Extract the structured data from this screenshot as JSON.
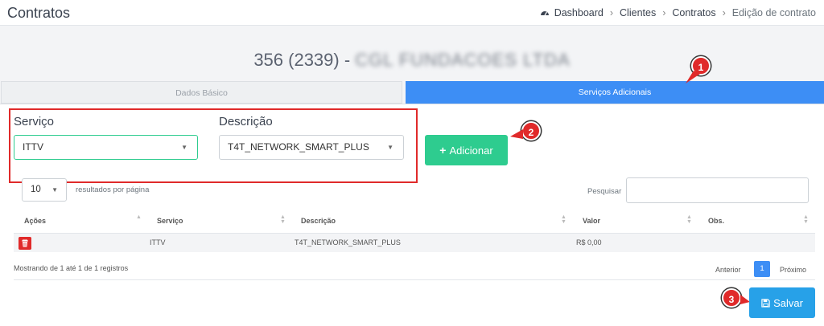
{
  "header": {
    "title": "Contratos",
    "breadcrumb": [
      "Dashboard",
      "Clientes",
      "Contratos",
      "Edição de contrato"
    ]
  },
  "contract": {
    "number": "356 (2339) -",
    "client_name": "CGL FUNDACOES LTDA"
  },
  "tabs": [
    {
      "label": "Dados Básico",
      "active": false
    },
    {
      "label": "Serviços Adicionais",
      "active": true
    }
  ],
  "form": {
    "service_label": "Serviço",
    "service_value": "ITTV",
    "description_label": "Descrição",
    "description_value": "T4T_NETWORK_SMART_PLUS",
    "add_button": "Adicionar"
  },
  "table_controls": {
    "page_length": "10",
    "page_length_label": "resultados por página",
    "search_label": "Pesquisar"
  },
  "table": {
    "columns": [
      "Ações",
      "Serviço",
      "Descrição",
      "Valor",
      "Obs."
    ],
    "rows": [
      {
        "servico": "ITTV",
        "descricao": "T4T_NETWORK_SMART_PLUS",
        "valor": "R$ 0,00",
        "obs": ""
      }
    ]
  },
  "footer": {
    "info": "Mostrando de 1 até 1 de 1 registros",
    "prev": "Anterior",
    "current_page": "1",
    "next": "Próximo",
    "save_button": "Salvar"
  },
  "annotations": [
    "1",
    "2",
    "3"
  ],
  "colors": {
    "primary": "#3d8ef5",
    "success": "#2ecc8f",
    "danger": "#e02a2a",
    "save": "#27a1e8"
  }
}
